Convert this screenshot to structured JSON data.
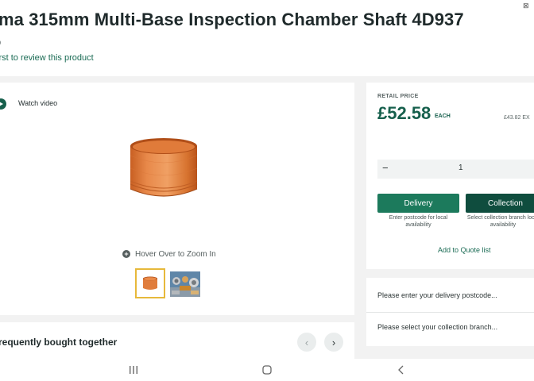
{
  "product": {
    "title": "ma 315mm Multi-Base Inspection Chamber Shaft 4D937",
    "rating_count": "0",
    "review_link": "irst to review this product"
  },
  "media": {
    "watch_video": "Watch video",
    "zoom_hint": "Hover Over to Zoom In",
    "thumbnails": [
      "product-photo",
      "product-photo-2"
    ]
  },
  "frequently_bought": {
    "title": "requently bought together"
  },
  "pricing": {
    "retail_label": "RETAIL PRICE",
    "price": "£52.58",
    "unit": "EACH",
    "price_ex_vat": "£43.82 EX"
  },
  "quantity": {
    "minus": "−",
    "value": "1",
    "plus": "+"
  },
  "actions": {
    "delivery_label": "Delivery",
    "delivery_hint": "Enter postcode for local availability",
    "collection_label": "Collection",
    "collection_hint": "Select collection branch local availability",
    "quote_link": "Add to Quote list"
  },
  "availability": {
    "delivery_prompt": "Please enter your delivery postcode...",
    "collection_prompt": "Please select your collection branch..."
  },
  "colors": {
    "accent_green": "#17604d",
    "collection_dark": "#0f4d3e",
    "thumb_selected": "#e7b93b"
  }
}
